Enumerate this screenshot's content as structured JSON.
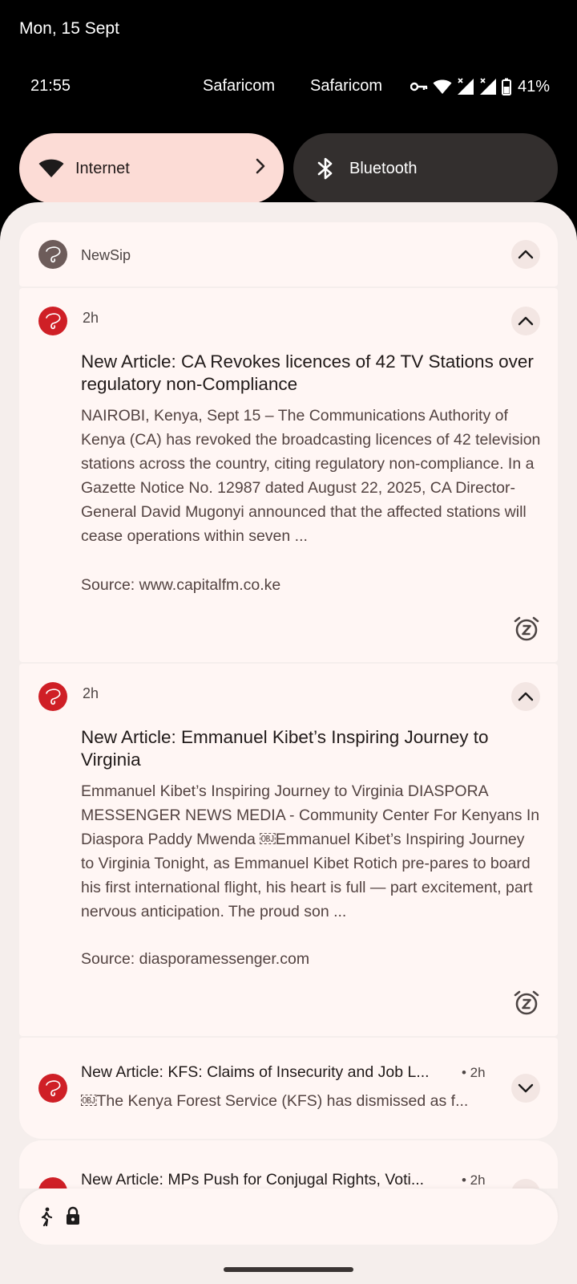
{
  "status": {
    "date": "Mon, 15 Sept",
    "time": "21:55",
    "carrier_1": "Safaricom",
    "carrier_2": "Safaricom",
    "battery_percent": "41%",
    "icons": [
      "vpn-key-icon",
      "wifi-icon",
      "signal-icon",
      "signal-icon",
      "battery-icon"
    ]
  },
  "quick_settings": {
    "internet_label": "Internet",
    "bluetooth_label": "Bluetooth"
  },
  "notification_group": {
    "app_name": "NewSip",
    "notifications": [
      {
        "time": "2h",
        "title": "New Article: CA Revokes licences of 42 TV Stations over regulatory non-Compliance",
        "body": "NAIROBI, Kenya, Sept 15 – The Communications Authority of Kenya (CA) has revoked the broadcasting licences of 42 television stations across the country, citing regulatory non-compliance. In a Gazette Notice No. 12987 dated August 22, 2025, CA Director-General David Mugonyi announced that the affected stations will cease operations within seven ...",
        "source": "Source: www.capitalfm.co.ke"
      },
      {
        "time": "2h",
        "title": "New Article: Emmanuel Kibet’s Inspiring Journey to Virginia",
        "body": "Emmanuel Kibet’s Inspiring Journey to Virginia DIASPORA MESSENGER NEWS MEDIA - Community Center For Kenyans In Diaspora Paddy Mwenda ￼Emmanuel Kibet’s Inspiring Journey to Virginia Tonight, as Emmanuel Kibet Rotich pre-pares to board his first international flight, his heart is full — part excitement, part nervous anticipation. The proud son ...",
        "source": "Source: diasporamessenger.com"
      },
      {
        "time": "• 2h",
        "title": "New Article: KFS: Claims of Insecurity and Job L...",
        "body": "￼The Kenya Forest Service (KFS) has dismissed as f..."
      },
      {
        "time": "• 2h",
        "title": "New Article: MPs Push for Conjugal Rights, Voti..."
      }
    ]
  },
  "colors": {
    "panel_bg": "#f5eeec",
    "card_bg": "#fff6f4",
    "internet_tile": "#fcdcd6",
    "bluetooth_tile": "#332f2e",
    "app_icon_red": "#cf1f26"
  }
}
